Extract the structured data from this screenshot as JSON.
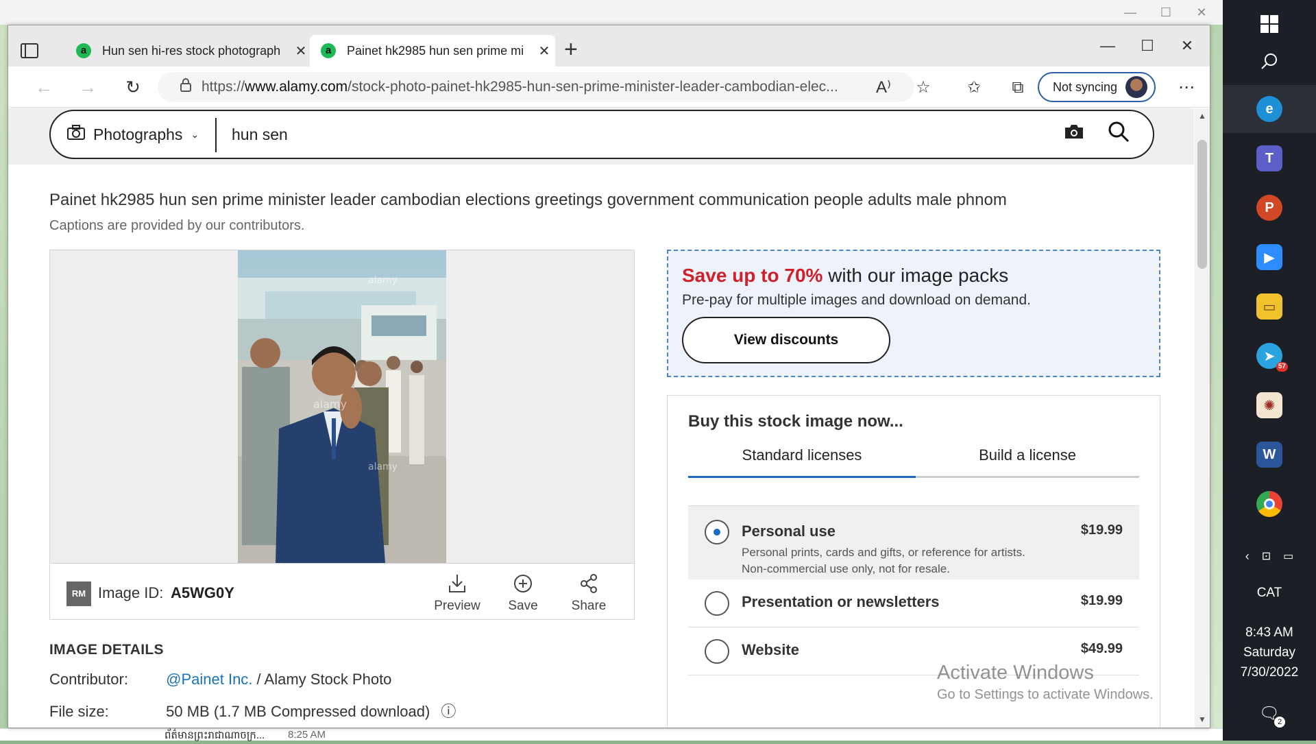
{
  "browser": {
    "tabs": [
      {
        "label": "Hun sen hi-res stock photograph",
        "favicon": "a",
        "active": false
      },
      {
        "label": "Painet hk2985 hun sen prime mi",
        "favicon": "a",
        "active": true
      }
    ],
    "address": {
      "url_prefix": "https://",
      "url_domain": "www.alamy.com",
      "url_path": "/stock-photo-painet-hk2985-hun-sen-prime-minister-leader-cambodian-elec..."
    },
    "profile_label": "Not syncing"
  },
  "search": {
    "category": "Photographs",
    "query": "hun sen"
  },
  "image": {
    "caption": "Painet hk2985 hun sen prime minister leader cambodian elections greetings government communication people adults male phnom",
    "caption_note": "Captions are provided by our contributors.",
    "badge": "RM",
    "id_label": "Image ID:",
    "id_value": "A5WG0Y",
    "actions": {
      "preview": "Preview",
      "save": "Save",
      "share": "Share"
    },
    "watermark": "alamy"
  },
  "details": {
    "title": "IMAGE DETAILS",
    "contributor_label": "Contributor:",
    "contributor_link": "@Painet Inc.",
    "contributor_suffix": "/ Alamy Stock Photo",
    "filesize_label": "File size:",
    "filesize_value": "50 MB (1.7 MB Compressed download)"
  },
  "promo": {
    "highlight": "Save up to 70%",
    "headline_rest": "with our image packs",
    "sub": "Pre-pay for multiple images and download on demand.",
    "button": "View discounts"
  },
  "buy": {
    "title": "Buy this stock image now...",
    "tabs": [
      "Standard licenses",
      "Build a license"
    ],
    "licenses": [
      {
        "name": "Personal use",
        "price": "$19.99",
        "desc1": "Personal prints, cards and gifts, or reference for artists.",
        "desc2": "Non-commercial use only, not for resale.",
        "selected": true
      },
      {
        "name": "Presentation or newsletters",
        "price": "$19.99",
        "selected": false
      },
      {
        "name": "Website",
        "price": "$49.99",
        "selected": false
      }
    ]
  },
  "watermark_windows": {
    "line1": "Activate Windows",
    "line2": "Go to Settings to activate Windows."
  },
  "background_app": {
    "message": "ព័ត៌មានព្រះរាជាណាចក្រ...",
    "time": "8:25 AM"
  },
  "taskbar": {
    "language": "CAT",
    "time": "8:43 AM",
    "day": "Saturday",
    "date": "7/30/2022",
    "telegram_badge": "57",
    "notification_count": "2",
    "colors": {
      "edge": "#1f8fd6",
      "teams": "#5b5fc7",
      "powerpoint": "#d24726",
      "zoom": "#2d8cff",
      "folder": "#f2c12e",
      "telegram": "#2aa3de",
      "word": "#2b579a",
      "chrome": "#4285f4"
    }
  },
  "colors": {
    "accent_red": "#d0202a",
    "link_blue": "#1a73b8",
    "tab_underline": "#1d6cc4",
    "promo_border": "#4d86c8"
  }
}
